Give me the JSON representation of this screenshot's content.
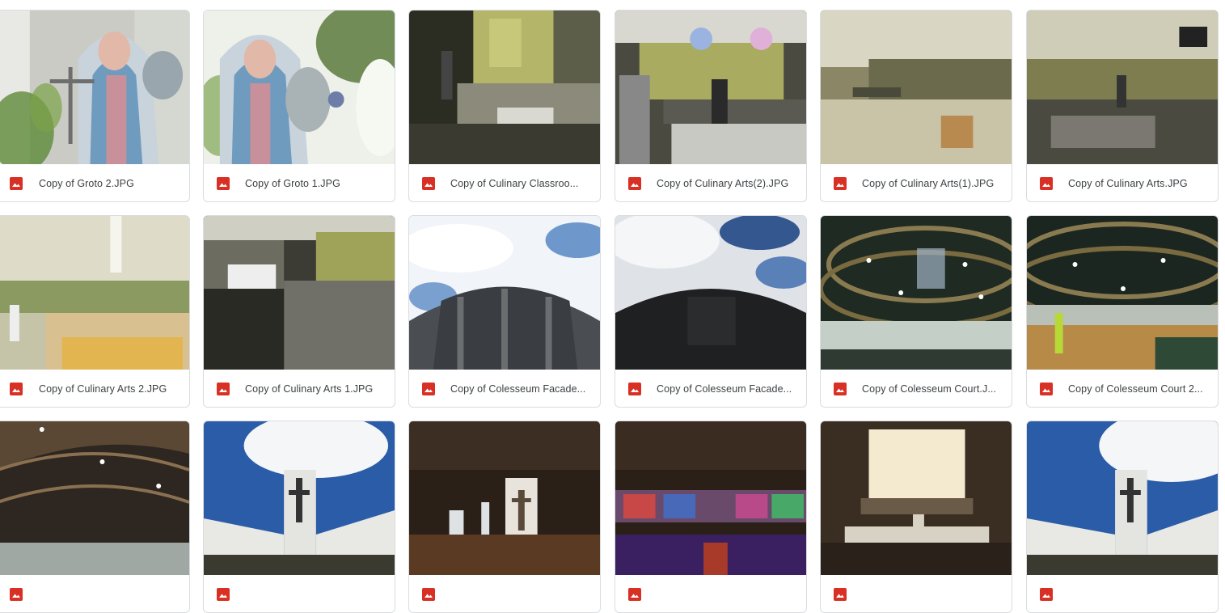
{
  "colors": {
    "image_icon": "#d93025",
    "text": "#3c4043",
    "border": "#dadce0"
  },
  "file_icon": "image-icon",
  "files": [
    {
      "name": "Copy of Groto 2.JPG"
    },
    {
      "name": "Copy of Groto 1.JPG"
    },
    {
      "name": "Copy of Culinary Classroo..."
    },
    {
      "name": "Copy of Culinary Arts(2).JPG"
    },
    {
      "name": "Copy of Culinary Arts(1).JPG"
    },
    {
      "name": "Copy of Culinary Arts.JPG"
    },
    {
      "name": "Copy of Culinary Arts 2.JPG"
    },
    {
      "name": "Copy of Culinary Arts 1.JPG"
    },
    {
      "name": "Copy of Colesseum Facade..."
    },
    {
      "name": "Copy of Colesseum Facade..."
    },
    {
      "name": "Copy of Colesseum Court.J..."
    },
    {
      "name": "Copy of Colesseum Court 2..."
    },
    {
      "name": ""
    },
    {
      "name": ""
    },
    {
      "name": ""
    },
    {
      "name": ""
    },
    {
      "name": ""
    },
    {
      "name": ""
    }
  ]
}
